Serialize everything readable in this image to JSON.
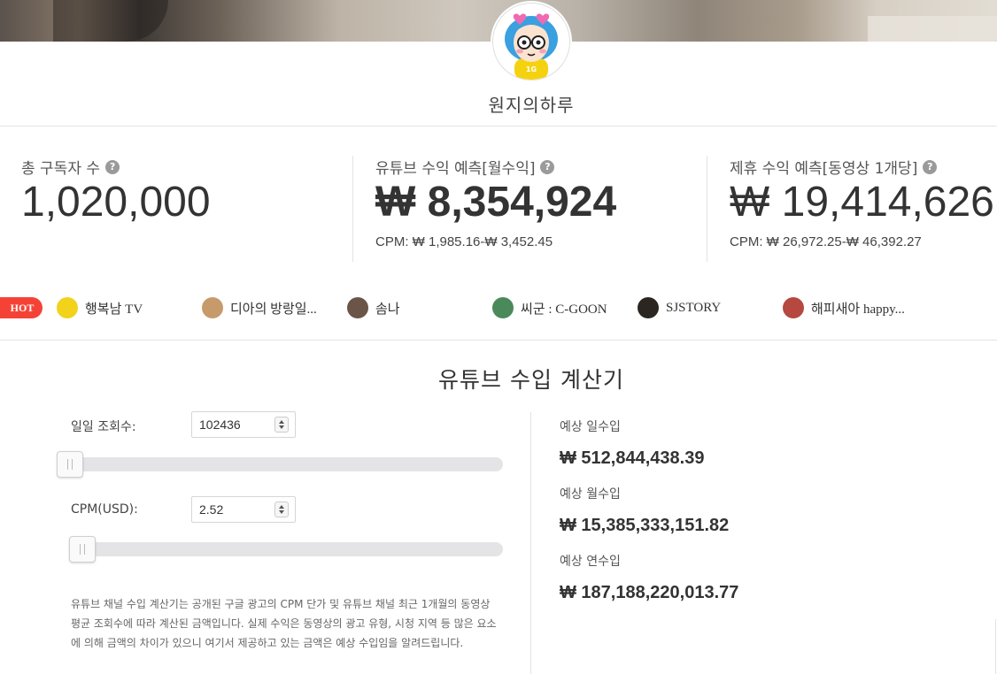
{
  "channel": {
    "name": "원지의하루",
    "avatar_icon": "cartoon-girl-glasses-avatar",
    "avatar_badge": "1G"
  },
  "stats": {
    "subscribers": {
      "label": "총 구독자 수",
      "value": "1,020,000"
    },
    "youtube_revenue": {
      "label": "유튜브 수익 예측[월수익]",
      "value": "₩ 8,354,924",
      "cpm": "CPM: ₩ 1,985.16-₩ 3,452.45"
    },
    "sponsor_revenue": {
      "label": "제휴 수익 예측[동영상 1개당]",
      "value": "₩ 19,414,626",
      "cpm": "CPM: ₩ 26,972.25-₩ 46,392.27"
    },
    "help_icon": "?"
  },
  "hot": {
    "badge": "HOT",
    "items": [
      {
        "name": "행복남 TV",
        "thumb_color": "#f2d21b"
      },
      {
        "name": "디아의 방랑일...",
        "thumb_color": "#c79a6b"
      },
      {
        "name": "솜나",
        "thumb_color": "#6b5548"
      },
      {
        "name": "씨군 : C-GOON",
        "thumb_color": "#4a8a5a"
      },
      {
        "name": "SJSTORY",
        "thumb_color": "#2b2620"
      },
      {
        "name": "해피새아 happy...",
        "thumb_color": "#b5493f"
      }
    ]
  },
  "calculator": {
    "title": "유튜브 수입 계산기",
    "daily_views": {
      "label": "일일 조회수:",
      "value": "102436",
      "slider_fraction": 0.0
    },
    "cpm": {
      "label": "CPM(USD):",
      "value": "2.52",
      "slider_fraction": 0.03
    },
    "notice": "유튜브 채널 수입 계산기는 공개된 구글 광고의 CPM 단가 및 유튜브 채널 최근 1개월의 동영상 평균 조회수에 따라 계산된 금액입니다. 실제 수익은 동영상의 광고 유형, 시청 지역 등 많은 요소에 의해 금액의 차이가 있으니 여기서 제공하고 있는 금액은 예상 수입임을 알려드립니다.",
    "results": {
      "daily": {
        "label": "예상 일수입",
        "value": "₩ 512,844,438.39"
      },
      "monthly": {
        "label": "예상 월수입",
        "value": "₩ 15,385,333,151.82"
      },
      "yearly": {
        "label": "예상 연수입",
        "value": "₩ 187,188,220,013.77"
      }
    }
  }
}
